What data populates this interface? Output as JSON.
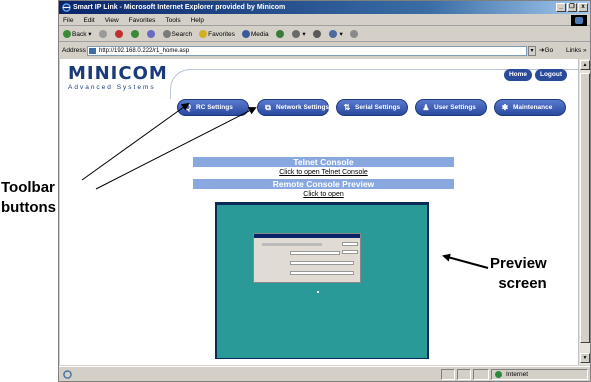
{
  "window": {
    "title": "Smart IP Link - Microsoft Internet Explorer provided by Minicom",
    "buttons": [
      "_",
      "❐",
      "x"
    ]
  },
  "menubar": {
    "items": [
      "File",
      "Edit",
      "View",
      "Favorites",
      "Tools",
      "Help"
    ]
  },
  "toolbar": {
    "back": "Back",
    "search": "Search",
    "favorites": "Favorites",
    "media": "Media"
  },
  "addressbar": {
    "label": "Address",
    "url": "http://192.168.0.222/r1_home.asp",
    "go": "Go",
    "links": "Links"
  },
  "brand": {
    "name": "MINICOM",
    "tagline": "Advanced Systems"
  },
  "top_buttons": {
    "home": "Home",
    "logout": "Logout"
  },
  "nav": {
    "rc_settings": "RC Settings",
    "network_settings": "Network Settings",
    "serial_settings": "Serial Settings",
    "user_settings": "User Settings",
    "maintenance": "Maintenance"
  },
  "content": {
    "telnet_header": "Telnet Console",
    "telnet_link": "Click to open Telnet Console",
    "preview_header": "Remote Console Preview",
    "preview_link": "Click to open"
  },
  "statusbar": {
    "zone": "Internet"
  },
  "annotations": {
    "toolbar_line1": "Toolbar",
    "toolbar_line2": "buttons",
    "preview_line1": "Preview",
    "preview_line2": "screen"
  },
  "colors": {
    "title_bar": "#0a246a",
    "nav_button": "#2a4aa0",
    "band": "#8aa8e0",
    "desktop": "#2a9a98"
  }
}
